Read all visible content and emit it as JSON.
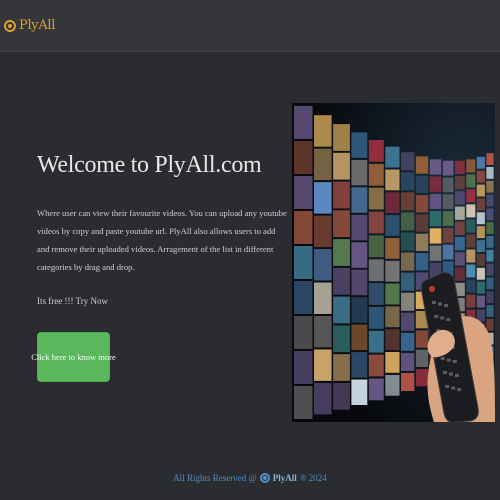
{
  "navbar": {
    "brand_name": "PlyAll",
    "logo_icon": "play-circle-icon",
    "accent_color": "#e0a030"
  },
  "hero": {
    "title": "Welcome to PlyAll.com",
    "description": "Where user can view their favourite videos. You can upload any youtube videos by copy and paste youtube url. PlyAll also allows users to add and remove their uploaded videos. Arragement of the list in different categories by drag and drop.",
    "free_text": "Its free !!! Try Now",
    "cta_label": "Click here to know more",
    "cta_color": "#5cb85c",
    "image_icon": "tv-wall-with-remote-image"
  },
  "footer": {
    "prefix": "All Rights Reserved @",
    "brand": "PlyAll",
    "suffix": "® 2024",
    "color": "#4f8fc4"
  }
}
